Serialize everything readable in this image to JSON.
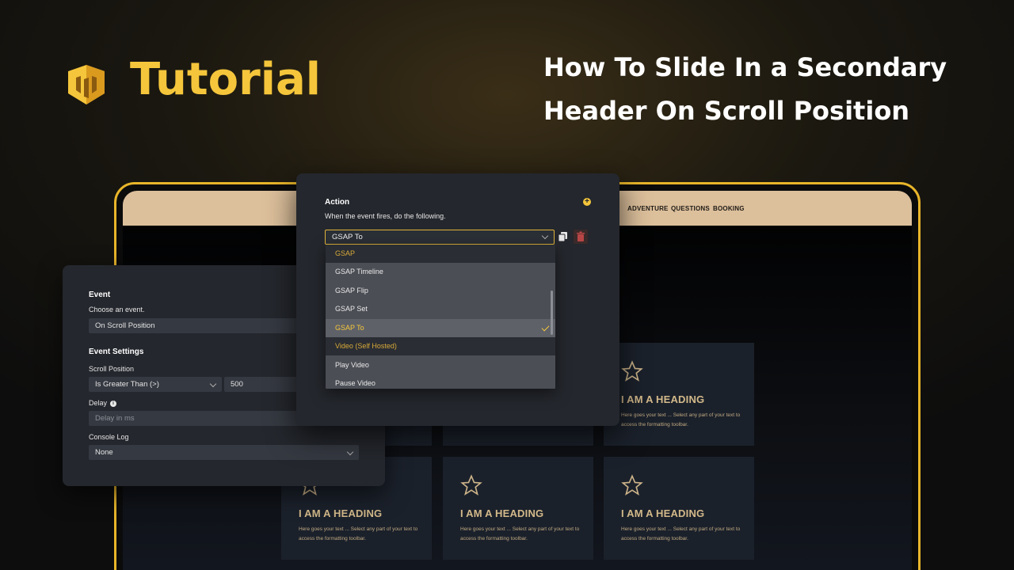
{
  "brand": {
    "title": "Tutorial",
    "logo_icon": "yellow-cube-logo-icon",
    "accent": "#f5c63b"
  },
  "headline": {
    "line1": "How To Slide In a Secondary",
    "line2": "Header On Scroll Position"
  },
  "site": {
    "nav": [
      "ADVENTURE",
      "QUESTIONS",
      "BOOKING"
    ],
    "card_heading": "I AM A HEADING",
    "card_text": "Here goes your text ... Select any part of your text to access the formatting toolbar."
  },
  "event_panel": {
    "event_label": "Event",
    "event_sub": "Choose an event.",
    "event_value": "On Scroll Position",
    "settings_label": "Event Settings",
    "scroll_label": "Scroll Position",
    "comparator_value": "Is Greater Than (>)",
    "scroll_value": "500",
    "delay_label": "Delay",
    "delay_placeholder": "Delay in ms",
    "console_label": "Console Log",
    "console_value": "None"
  },
  "action_panel": {
    "title": "Action",
    "sub": "When the event fires, do the following.",
    "select_value": "GSAP To",
    "dropdown": [
      {
        "label": "GSAP",
        "kind": "group"
      },
      {
        "label": "GSAP Timeline",
        "kind": "item"
      },
      {
        "label": "GSAP Flip",
        "kind": "item"
      },
      {
        "label": "GSAP Set",
        "kind": "item"
      },
      {
        "label": "GSAP To",
        "kind": "selected"
      },
      {
        "label": "Video (Self Hosted)",
        "kind": "group"
      },
      {
        "label": "Play Video",
        "kind": "item"
      },
      {
        "label": "Pause Video",
        "kind": "item"
      }
    ]
  }
}
